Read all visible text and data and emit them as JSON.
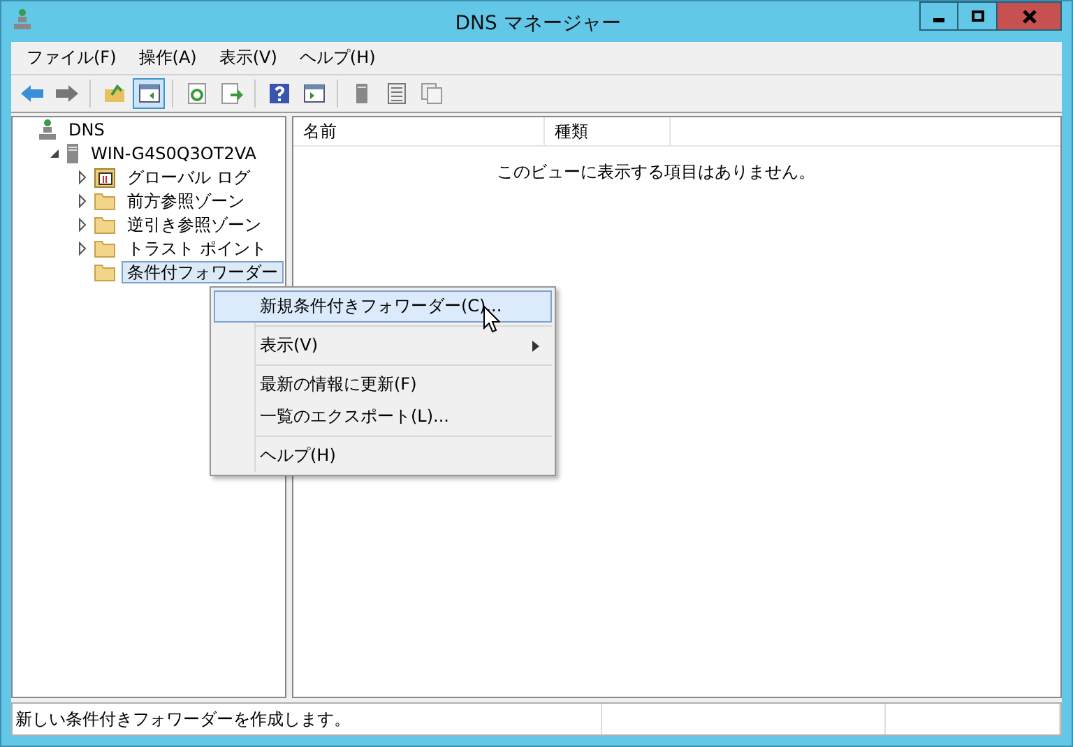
{
  "window": {
    "title": "DNS マネージャー"
  },
  "menu": [
    "ファイル(F)",
    "操作(A)",
    "表示(V)",
    "ヘルプ(H)"
  ],
  "toolbar": [
    {
      "kind": "back",
      "pressed": false
    },
    {
      "kind": "forward",
      "pressed": false
    },
    {
      "kind": "sep"
    },
    {
      "kind": "up",
      "pressed": false
    },
    {
      "kind": "tree",
      "pressed": true
    },
    {
      "kind": "sep"
    },
    {
      "kind": "refresh",
      "pressed": false
    },
    {
      "kind": "export",
      "pressed": false
    },
    {
      "kind": "sep"
    },
    {
      "kind": "help",
      "pressed": false
    },
    {
      "kind": "pane",
      "pressed": false
    },
    {
      "kind": "sep"
    },
    {
      "kind": "server",
      "pressed": false
    },
    {
      "kind": "list",
      "pressed": false
    },
    {
      "kind": "copy",
      "pressed": false
    }
  ],
  "tree": [
    {
      "label": "DNS",
      "kind": "dns",
      "selected": false,
      "children": [
        {
          "label": "WIN-G4S0Q3OT2VA",
          "kind": "server",
          "expanded": true,
          "selected": false,
          "children": [
            {
              "label": "グローバル ログ",
              "kind": "log",
              "expanded": false,
              "selected": false
            },
            {
              "label": "前方参照ゾーン",
              "kind": "folder",
              "expanded": false,
              "selected": false
            },
            {
              "label": "逆引き参照ゾーン",
              "kind": "folder",
              "expanded": false,
              "selected": false
            },
            {
              "label": "トラスト ポイント",
              "kind": "folder",
              "expanded": false,
              "selected": false
            },
            {
              "label": "条件付フォワーダー",
              "kind": "folder",
              "selected": true
            }
          ]
        }
      ]
    }
  ],
  "list": {
    "columns": [
      "名前",
      "種類"
    ],
    "empty_message": "このビューに表示する項目はありません。"
  },
  "context_menu": [
    {
      "kind": "item",
      "label": "新規条件付きフォワーダー(C)...",
      "selected": true
    },
    {
      "kind": "separator"
    },
    {
      "kind": "item",
      "label": "表示(V)",
      "selected": false,
      "submenu": true
    },
    {
      "kind": "separator"
    },
    {
      "kind": "item",
      "label": "最新の情報に更新(F)",
      "selected": false
    },
    {
      "kind": "item",
      "label": "一覧のエクスポート(L)...",
      "selected": false
    },
    {
      "kind": "separator"
    },
    {
      "kind": "item",
      "label": "ヘルプ(H)",
      "selected": false
    }
  ],
  "status_bar": [
    "新しい条件付きフォワーダーを作成します。"
  ]
}
